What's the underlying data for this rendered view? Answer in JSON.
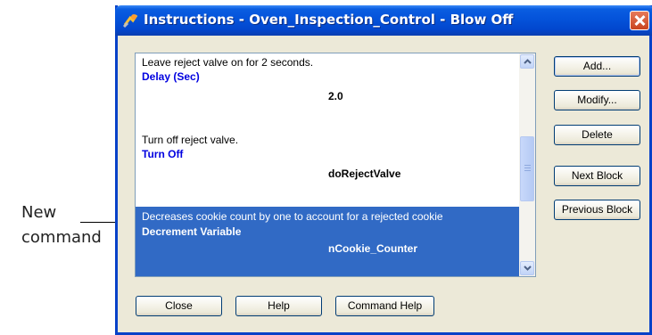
{
  "callout": {
    "line1": "New",
    "line2": "command"
  },
  "window": {
    "title": "Instructions - Oven_Inspection_Control - Blow Off"
  },
  "list": {
    "entries": [
      {
        "comment": "Leave reject valve on for 2 seconds.",
        "command": "Delay (Sec)",
        "param": "2.0",
        "selected": false
      },
      {
        "comment": "Turn off reject valve.",
        "command": "Turn Off",
        "param": "doRejectValve",
        "selected": false
      },
      {
        "comment": "Decreases cookie count by one to account for a rejected cookie",
        "command": "Decrement Variable",
        "param": "nCookie_Counter",
        "selected": true
      }
    ]
  },
  "side_buttons": {
    "add": "Add...",
    "modify": "Modify...",
    "delete": "Delete",
    "next_block": "Next Block",
    "previous_block": "Previous Block"
  },
  "bottom_buttons": {
    "close": "Close",
    "help": "Help",
    "command_help": "Command Help"
  },
  "colors": {
    "titlebar": "#0453da",
    "selection": "#316ac5",
    "command_text": "#0000e0"
  },
  "icons": {
    "title": "lightning-wrench-icon",
    "close": "close-icon",
    "scroll_up": "chevron-up-icon",
    "scroll_down": "chevron-down-icon"
  }
}
